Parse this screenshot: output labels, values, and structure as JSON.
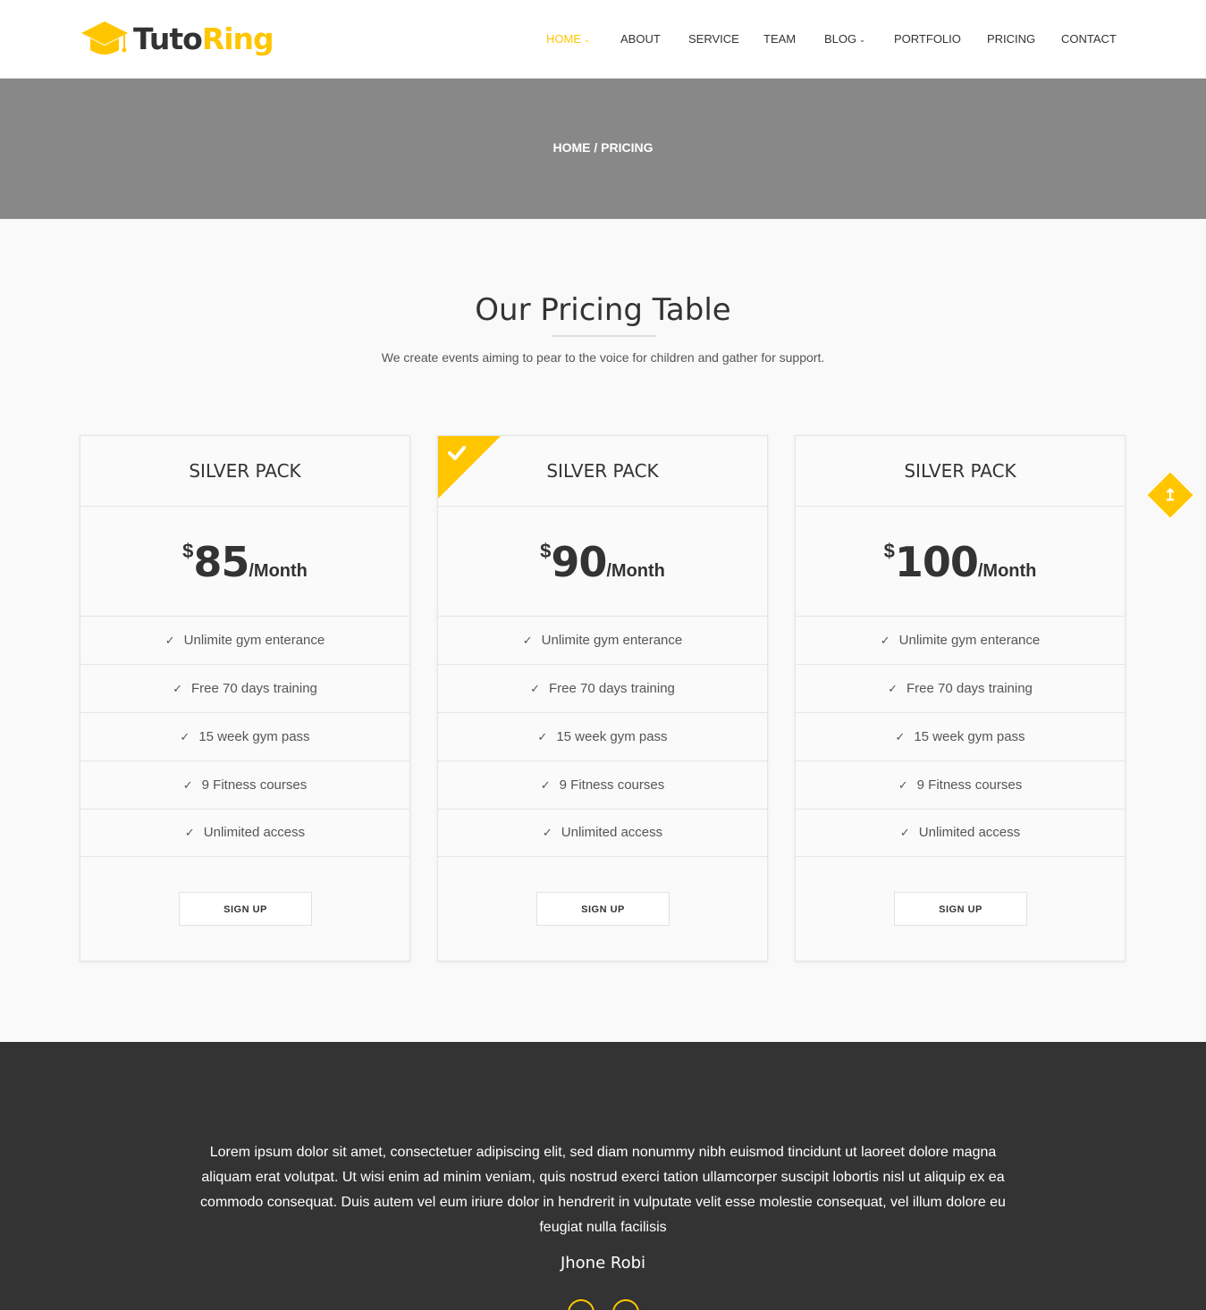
{
  "brand": {
    "part1": "Tuto",
    "part2": "Ring",
    "accent": "#ffc600"
  },
  "nav": {
    "items": [
      {
        "label": "HOME",
        "chevron": "chevron-down-icon",
        "active": true
      },
      {
        "label": "ABOUT"
      },
      {
        "label": "SERVICE"
      },
      {
        "label": "TEAM"
      },
      {
        "label": "BLOG",
        "chevron": "chevron-down-icon"
      },
      {
        "label": "PORTFOLIO"
      },
      {
        "label": "PRICING"
      },
      {
        "label": "CONTACT"
      }
    ]
  },
  "breadcrumb": {
    "home": "HOME",
    "sep": " / ",
    "current": "PRICING"
  },
  "section": {
    "title": "Our Pricing Table",
    "subtitle": "We create events aiming to pear to the voice for children and gather for support."
  },
  "pricing": {
    "currency": "$",
    "period": "/Month",
    "signup_label": "SIGN UP",
    "plans": [
      {
        "name": "SILVER PACK",
        "price": "85",
        "featured": false,
        "features": [
          "Unlimite gym enterance",
          "Free 70 days training",
          "15 week gym pass",
          "9 Fitness courses",
          "Unlimited access"
        ]
      },
      {
        "name": "SILVER PACK",
        "price": "90",
        "featured": true,
        "features": [
          "Unlimite gym enterance",
          "Free 70 days training",
          "15 week gym pass",
          "9 Fitness courses",
          "Unlimited access"
        ]
      },
      {
        "name": "SILVER PACK",
        "price": "100",
        "featured": false,
        "features": [
          "Unlimite gym enterance",
          "Free 70 days training",
          "15 week gym pass",
          "9 Fitness courses",
          "Unlimited access"
        ]
      }
    ]
  },
  "testimonial": {
    "text": "Lorem ipsum dolor sit amet, consectetuer adipiscing elit, sed diam nonummy nibh euismod tincidunt ut laoreet dolore magna aliquam erat volutpat. Ut wisi enim ad minim veniam, quis nostrud exerci tation ullamcorper suscipit lobortis nisl ut aliquip ex ea commodo consequat. Duis autem vel eum iriure dolor in hendrerit in vulputate velit esse molestie consequat, vel illum dolore eu feugiat nulla facilisis",
    "author": "Jhone Robi"
  },
  "icons": {
    "logo": "graduation-cap-icon",
    "check": "check-icon",
    "scroll": "arrow-up-icon"
  }
}
